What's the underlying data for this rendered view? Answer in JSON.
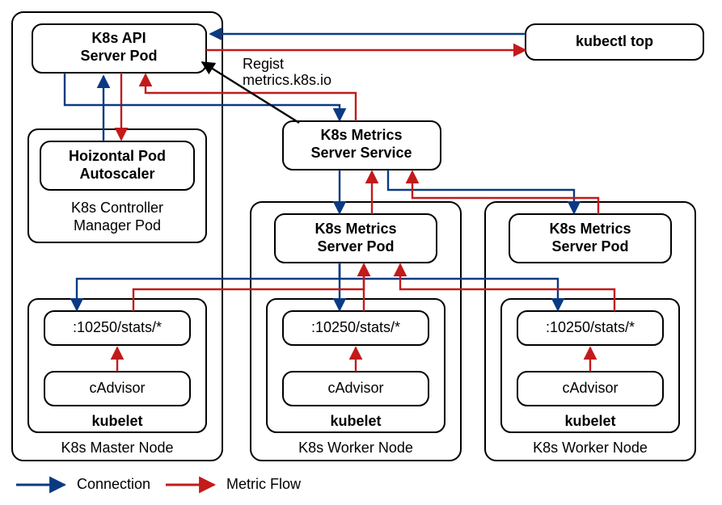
{
  "nodes": {
    "api": {
      "l1": "K8s API",
      "l2": "Server Pod"
    },
    "kubectl": {
      "l1": "kubectl top"
    },
    "hpa": {
      "l1": "Hoizontal Pod",
      "l2": "Autoscaler"
    },
    "cmpod": {
      "l1": "K8s Controller",
      "l2": "Manager Pod"
    },
    "msvc": {
      "l1": "K8s Metrics",
      "l2": "Server Service"
    },
    "mpod1": {
      "l1": "K8s Metrics",
      "l2": "Server Pod"
    },
    "mpod2": {
      "l1": "K8s Metrics",
      "l2": "Server Pod"
    },
    "stats": {
      "l1": ":10250/stats/*"
    },
    "cadv": {
      "l1": "cAdvisor"
    },
    "kubelet": {
      "l1": "kubelet"
    },
    "master": {
      "l1": "K8s Master Node"
    },
    "worker": {
      "l1": "K8s Worker Node"
    }
  },
  "labels": {
    "regist1": "Regist",
    "regist2": "metrics.k8s.io",
    "legend_conn": "Connection",
    "legend_flow": "Metric Flow"
  }
}
